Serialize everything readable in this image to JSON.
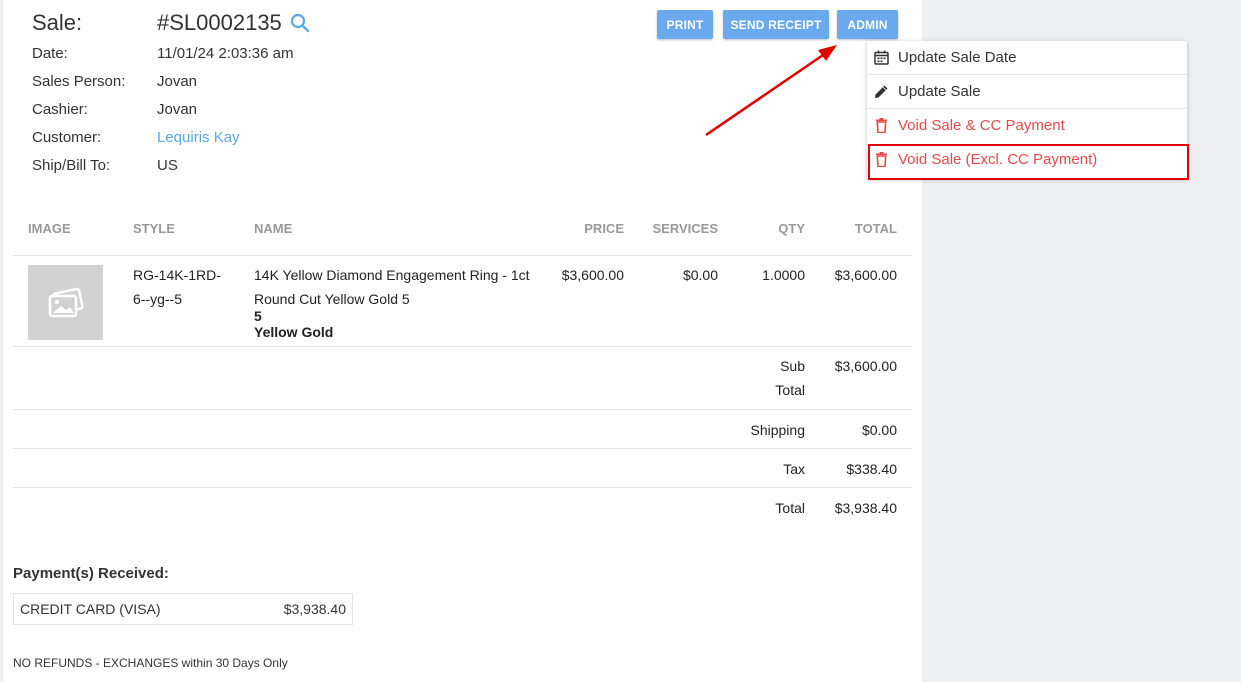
{
  "sale": {
    "title_label": "Sale:",
    "number": "#SL0002135",
    "fields": [
      {
        "label": "Date:",
        "value": "11/01/24 2:03:36 am"
      },
      {
        "label": "Sales Person:",
        "value": "Jovan"
      },
      {
        "label": "Cashier:",
        "value": "Jovan"
      },
      {
        "label": "Customer:",
        "value": "Lequiris Kay"
      },
      {
        "label": "Ship/Bill To:",
        "value": "US"
      }
    ]
  },
  "toolbar": {
    "print_label": "PRINT",
    "send_receipt_label": "SEND RECEIPT",
    "admin_label": "ADMIN"
  },
  "admin_menu": {
    "items": [
      {
        "label": "Update Sale Date",
        "icon": "calendar-icon"
      },
      {
        "label": "Update Sale",
        "icon": "pencil-icon"
      },
      {
        "label": "Void Sale & CC Payment",
        "icon": "trash-icon"
      },
      {
        "label": "Void Sale (Excl. CC Payment)",
        "icon": "trash-icon"
      }
    ]
  },
  "table": {
    "headers": [
      "IMAGE",
      "STYLE",
      "NAME",
      "PRICE",
      "SERVICES",
      "QTY",
      "TOTAL"
    ],
    "rows": [
      {
        "style": [
          "RG-14K-1RD-",
          "6--yg--5"
        ],
        "name": [
          "14K Yellow Diamond Engagement Ring - 1ct",
          "Round Cut Yellow Gold 5"
        ],
        "size": "5",
        "metal": "Yellow Gold",
        "price": "$3,600.00",
        "services": "$0.00",
        "qty": "1.0000",
        "total": "$3,600.00"
      }
    ]
  },
  "totals": {
    "subtotal_label": [
      "Sub",
      "Total"
    ],
    "subtotal": "$3,600.00",
    "shipping_label": "Shipping",
    "shipping": "$0.00",
    "tax_label": "Tax",
    "tax": "$338.40",
    "total_label": "Total",
    "total": "$3,938.40"
  },
  "payments": {
    "title": "Payment(s) Received:",
    "items": [
      {
        "method": "CREDIT CARD (VISA)",
        "amount": "$3,938.40"
      }
    ]
  },
  "footer_note": "NO REFUNDS - EXCHANGES within 30 Days Only",
  "colors": {
    "accent": "#6aa9ee",
    "link": "#5aa7e6",
    "danger": "#e24b4b",
    "highlight": "#e00000"
  }
}
